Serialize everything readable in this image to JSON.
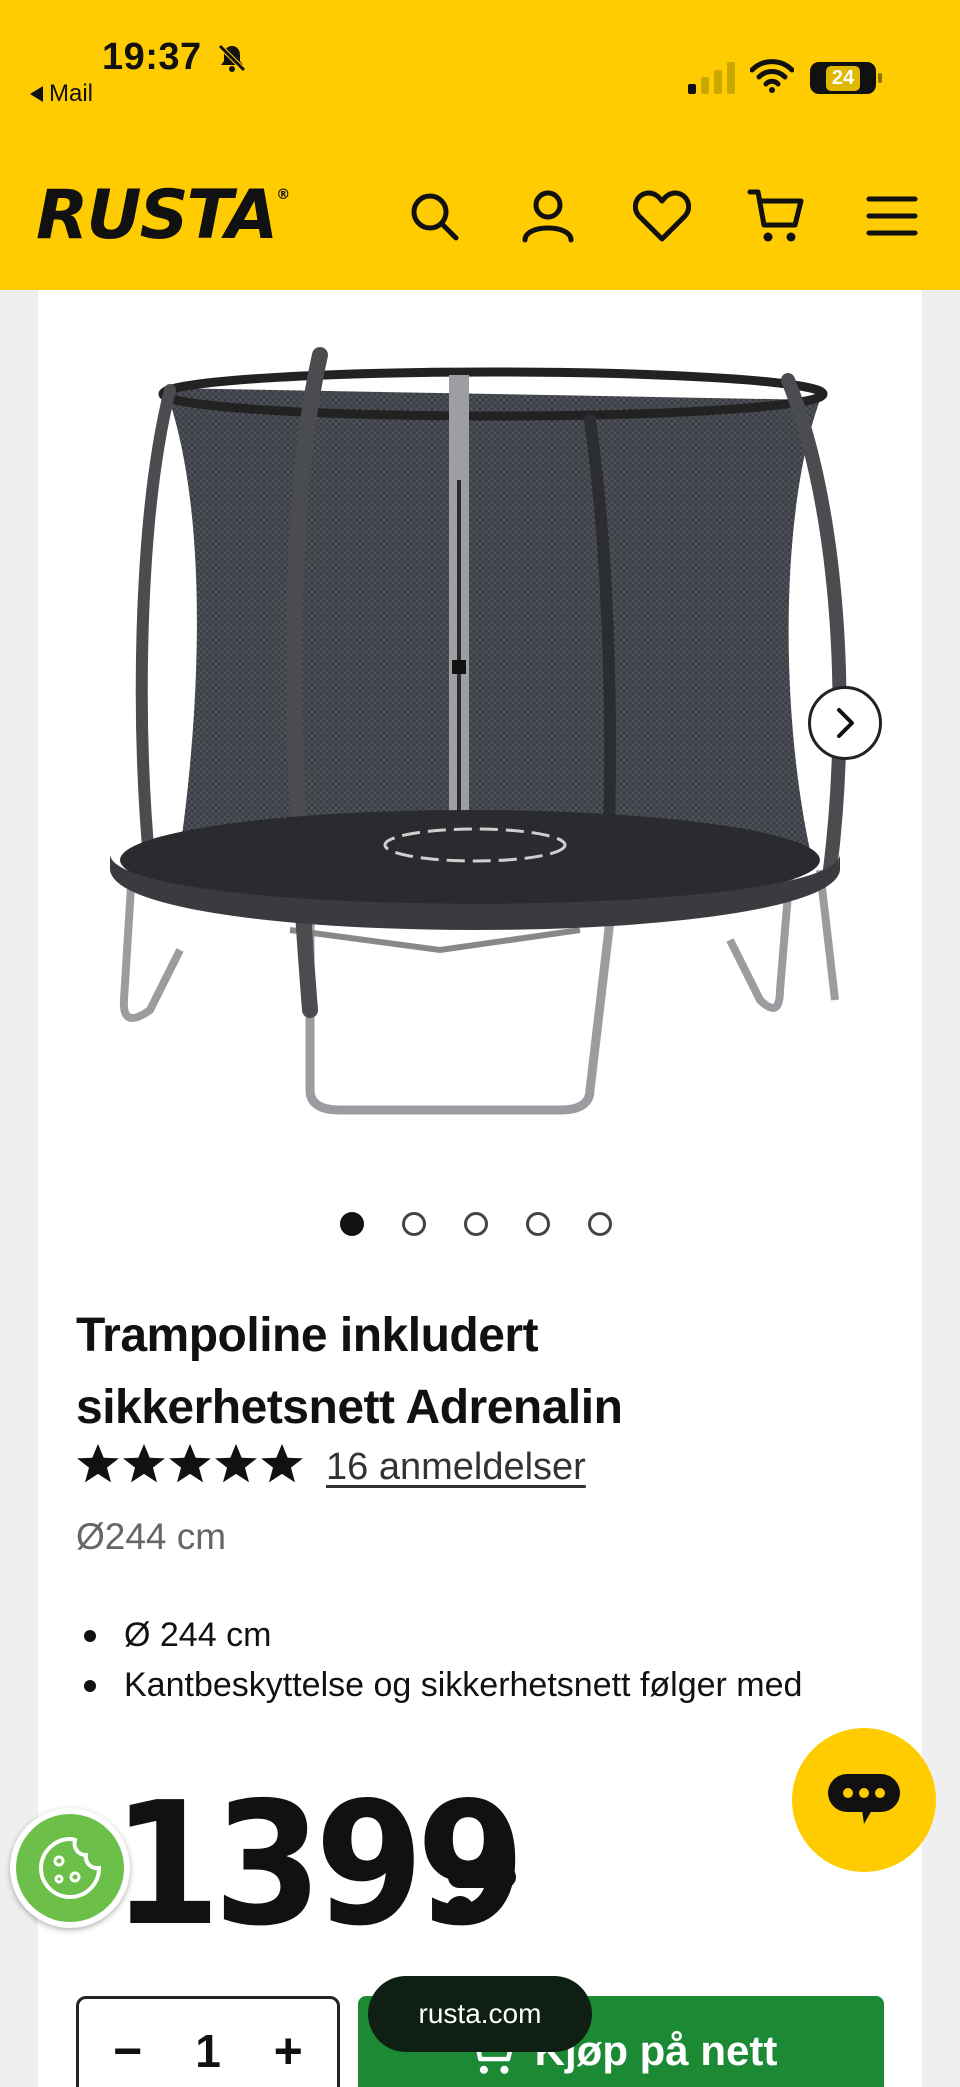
{
  "status_bar": {
    "time": "19:37",
    "back_app": "Mail",
    "battery": "24"
  },
  "header": {
    "logo": "RUSTA",
    "logo_mark": "®",
    "icons": [
      "search-icon",
      "account-icon",
      "heart-icon",
      "cart-icon",
      "menu-icon"
    ]
  },
  "carousel": {
    "image_count": 5,
    "active_index": 0
  },
  "product": {
    "title": "Trampoline inkludert sikkerhetsnett Adrenalin",
    "rating": 5,
    "reviews": "16 anmeldelser",
    "size": "Ø244 cm",
    "bullets": [
      "Ø 244 cm",
      "Kantbeskyttelse og sikkerhetsnett følger med"
    ],
    "price": "1399"
  },
  "purchase": {
    "qty_minus": "−",
    "quantity": "1",
    "qty_plus": "+",
    "buy_label": "Kjøp på nett"
  },
  "browser": {
    "url": "rusta.com"
  },
  "colors": {
    "brand_yellow": "#fecc00",
    "buy_green": "#1c8a35",
    "cookie_green": "#6cc04a"
  }
}
